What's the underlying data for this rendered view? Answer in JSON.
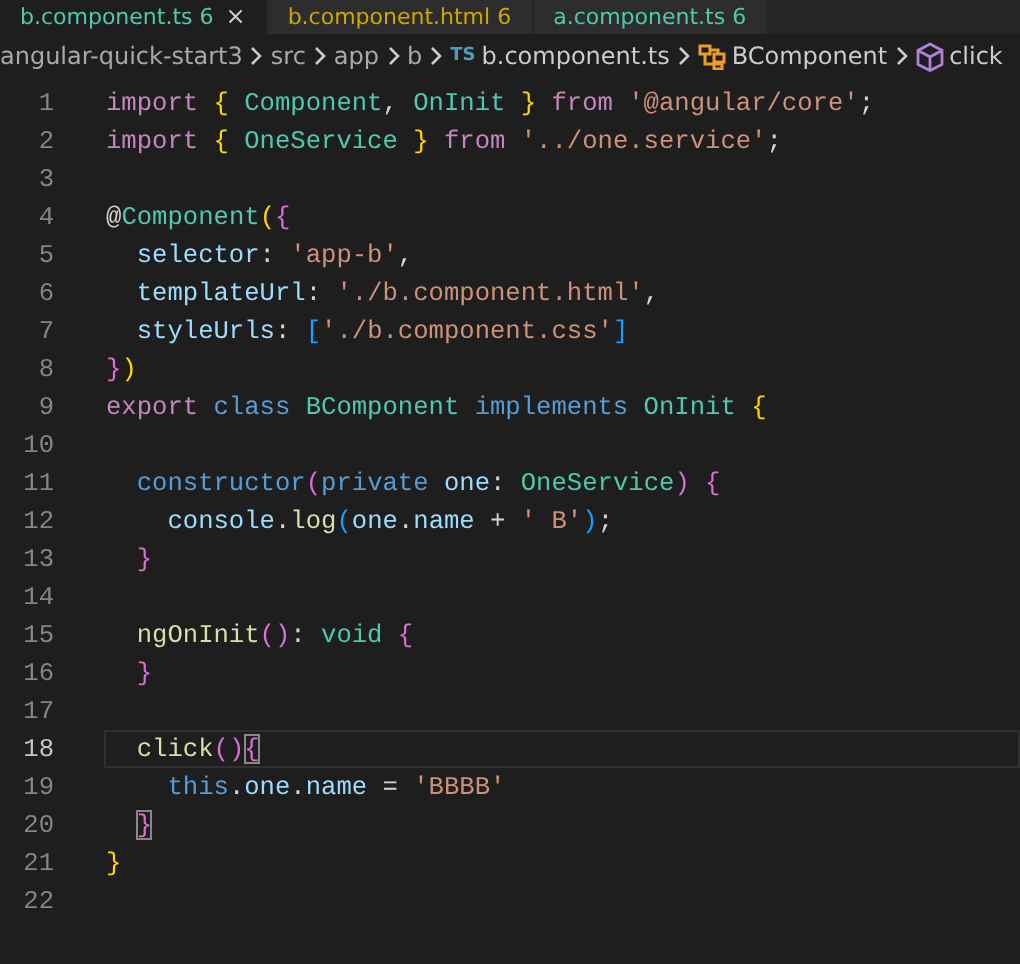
{
  "tabs": [
    {
      "label": "b.component.ts",
      "badge": "6",
      "selected": true,
      "color": "#4ec9b0",
      "close": "×"
    },
    {
      "label": "b.component.html",
      "badge": "6",
      "selected": false,
      "color": "#cca700"
    },
    {
      "label": "a.component.ts",
      "badge": "6",
      "selected": false,
      "color": "#4ec9b0"
    }
  ],
  "breadcrumbs": [
    {
      "kind": "folder",
      "label": "angular-quick-start3"
    },
    {
      "kind": "folder",
      "label": "src"
    },
    {
      "kind": "folder",
      "label": "app"
    },
    {
      "kind": "folder",
      "label": "b"
    },
    {
      "kind": "ts-file",
      "label": "b.component.ts",
      "badge": "TS"
    },
    {
      "kind": "class",
      "label": "BComponent"
    },
    {
      "kind": "method",
      "label": "click"
    }
  ],
  "lines": [
    {
      "number": "1",
      "current": false,
      "tokens": [
        {
          "kind": "keyword",
          "text": "import"
        },
        {
          "kind": "bracket1",
          "text": " {"
        },
        {
          "kind": "type",
          "text": " Component"
        },
        {
          "kind": "plain",
          "text": ","
        },
        {
          "kind": "type",
          "text": " OnInit"
        },
        {
          "kind": "bracket1",
          "text": " }"
        },
        {
          "kind": "keyword",
          "text": " from"
        },
        {
          "kind": "string",
          "text": " '@angular/core'"
        },
        {
          "kind": "plain",
          "text": ";"
        }
      ]
    },
    {
      "number": "2",
      "current": false,
      "tokens": [
        {
          "kind": "keyword",
          "text": "import"
        },
        {
          "kind": "bracket1",
          "text": " {"
        },
        {
          "kind": "type",
          "text": " OneService"
        },
        {
          "kind": "bracket1",
          "text": " }"
        },
        {
          "kind": "keyword",
          "text": " from"
        },
        {
          "kind": "string",
          "text": " '../one.service'"
        },
        {
          "kind": "plain",
          "text": ";"
        }
      ]
    },
    {
      "number": "3",
      "current": false
    },
    {
      "number": "4",
      "current": false,
      "tokens": [
        {
          "kind": "plain",
          "text": "@"
        },
        {
          "kind": "type",
          "text": "Component"
        },
        {
          "kind": "bracket1",
          "text": "("
        },
        {
          "kind": "bracket2",
          "text": "{"
        }
      ]
    },
    {
      "number": "5",
      "current": false,
      "tokens": [
        {
          "kind": "variable",
          "text": "  selector"
        },
        {
          "kind": "plain",
          "text": ":"
        },
        {
          "kind": "string",
          "text": " 'app-b'"
        },
        {
          "kind": "plain",
          "text": ","
        }
      ]
    },
    {
      "number": "6",
      "current": false,
      "tokens": [
        {
          "kind": "variable",
          "text": "  templateUrl"
        },
        {
          "kind": "plain",
          "text": ":"
        },
        {
          "kind": "string",
          "text": " './b.component.html'"
        },
        {
          "kind": "plain",
          "text": ","
        }
      ]
    },
    {
      "number": "7",
      "current": false,
      "tokens": [
        {
          "kind": "variable",
          "text": "  styleUrls"
        },
        {
          "kind": "plain",
          "text": ":"
        },
        {
          "kind": "bracket3",
          "text": " ["
        },
        {
          "kind": "string",
          "text": "'./b.component.css'"
        },
        {
          "kind": "bracket3",
          "text": "]"
        }
      ]
    },
    {
      "number": "8",
      "current": false,
      "tokens": [
        {
          "kind": "bracket2",
          "text": "}"
        },
        {
          "kind": "bracket1",
          "text": ")"
        }
      ]
    },
    {
      "number": "9",
      "current": false,
      "tokens": [
        {
          "kind": "keyword",
          "text": "export"
        },
        {
          "kind": "storage",
          "text": " class"
        },
        {
          "kind": "type",
          "text": " BComponent"
        },
        {
          "kind": "storage",
          "text": " implements"
        },
        {
          "kind": "type",
          "text": " OnInit"
        },
        {
          "kind": "bracket1",
          "text": " {"
        }
      ]
    },
    {
      "number": "10",
      "current": false
    },
    {
      "number": "11",
      "current": false,
      "tokens": [
        {
          "kind": "storage",
          "text": "  constructor"
        },
        {
          "kind": "bracket2",
          "text": "("
        },
        {
          "kind": "storage",
          "text": "private"
        },
        {
          "kind": "variable",
          "text": " one"
        },
        {
          "kind": "plain",
          "text": ":"
        },
        {
          "kind": "type",
          "text": " OneService"
        },
        {
          "kind": "bracket2",
          "text": ")"
        },
        {
          "kind": "bracket2",
          "text": " {"
        }
      ]
    },
    {
      "number": "12",
      "current": false,
      "tokens": [
        {
          "kind": "variable",
          "text": "    console"
        },
        {
          "kind": "plain",
          "text": "."
        },
        {
          "kind": "function",
          "text": "log"
        },
        {
          "kind": "bracket3",
          "text": "("
        },
        {
          "kind": "variable",
          "text": "one"
        },
        {
          "kind": "plain",
          "text": "."
        },
        {
          "kind": "variable",
          "text": "name"
        },
        {
          "kind": "plain",
          "text": " +"
        },
        {
          "kind": "string",
          "text": " ' B'"
        },
        {
          "kind": "bracket3",
          "text": ")"
        },
        {
          "kind": "plain",
          "text": ";"
        }
      ]
    },
    {
      "number": "13",
      "current": false,
      "tokens": [
        {
          "kind": "bracket2",
          "text": "  }"
        }
      ]
    },
    {
      "number": "14",
      "current": false
    },
    {
      "number": "15",
      "current": false,
      "tokens": [
        {
          "kind": "function",
          "text": "  ngOnInit"
        },
        {
          "kind": "bracket2",
          "text": "()"
        },
        {
          "kind": "plain",
          "text": ":"
        },
        {
          "kind": "type",
          "text": " void"
        },
        {
          "kind": "bracket2",
          "text": " {"
        }
      ]
    },
    {
      "number": "16",
      "current": false,
      "tokens": [
        {
          "kind": "bracket2",
          "text": "  }"
        }
      ]
    },
    {
      "number": "17",
      "current": false
    },
    {
      "number": "18",
      "current": true,
      "tokens": [
        {
          "kind": "function",
          "text": "  click"
        },
        {
          "kind": "bracket2",
          "text": "()"
        },
        {
          "kind": "match",
          "text": "{"
        }
      ]
    },
    {
      "number": "19",
      "current": false,
      "tokens": [
        {
          "kind": "storage",
          "text": "    this"
        },
        {
          "kind": "plain",
          "text": "."
        },
        {
          "kind": "variable",
          "text": "one"
        },
        {
          "kind": "plain",
          "text": "."
        },
        {
          "kind": "variable",
          "text": "name"
        },
        {
          "kind": "plain",
          "text": " ="
        },
        {
          "kind": "string",
          "text": " 'BBBB'"
        }
      ]
    },
    {
      "number": "20",
      "current": false,
      "tokens": [
        {
          "kind": "match",
          "text": "  }"
        }
      ]
    },
    {
      "number": "21",
      "current": false,
      "tokens": [
        {
          "kind": "bracket1",
          "text": "}"
        }
      ]
    },
    {
      "number": "22",
      "current": false
    }
  ]
}
